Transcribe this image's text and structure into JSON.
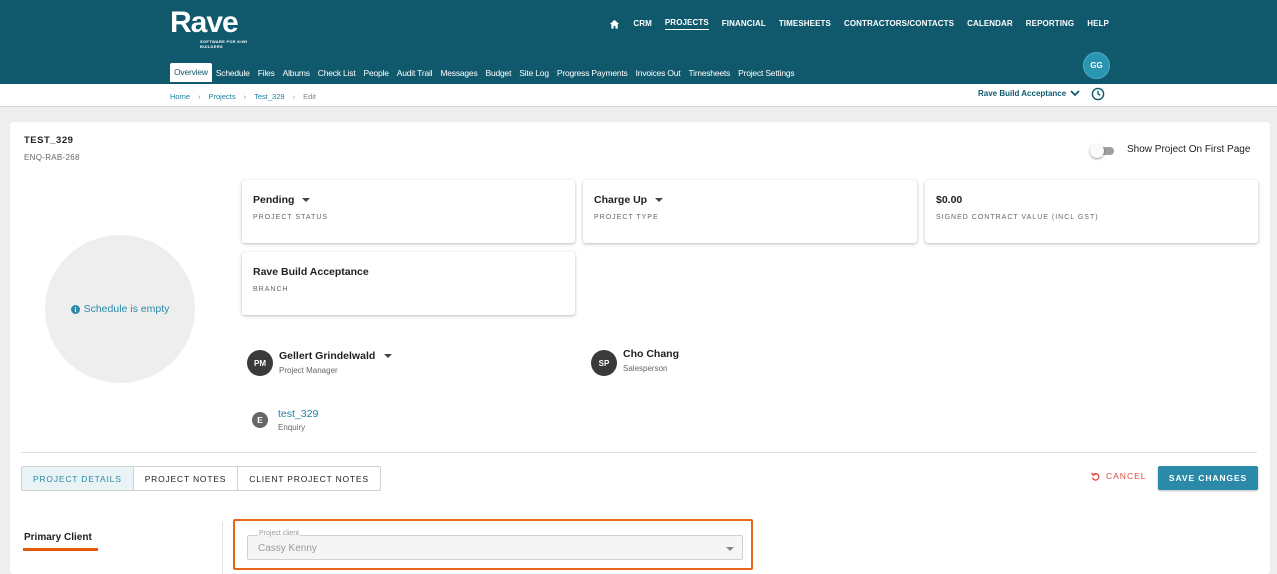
{
  "header": {
    "logo_word": "Rave",
    "logo_tagline": "SOFTWARE FOR KIWI BUILDERS",
    "top_nav": [
      "CRM",
      "PROJECTS",
      "FINANCIAL",
      "TIMESHEETS",
      "CONTRACTORS/CONTACTS",
      "CALENDAR",
      "REPORTING",
      "HELP"
    ],
    "active_top_nav": "PROJECTS",
    "user_initials": "GG",
    "sub_nav": [
      "Overview",
      "Schedule",
      "Files",
      "Albums",
      "Check List",
      "People",
      "Audit Trail",
      "Messages",
      "Budget",
      "Site Log",
      "Progress Payments",
      "Invoices Out",
      "Timesheets",
      "Project Settings"
    ],
    "active_sub_nav": "Overview"
  },
  "breadcrumb": {
    "home": "Home",
    "projects": "Projects",
    "project": "Test_329",
    "current": "Edit"
  },
  "branch_selector": "Rave Build Acceptance",
  "project": {
    "name": "TEST_329",
    "code": "ENQ-RAB-268",
    "show_first_page_label": "Show Project On First Page",
    "show_first_page_on": false,
    "schedule_text": "Schedule is empty"
  },
  "info_boxes": {
    "status": {
      "value": "Pending",
      "label": "PROJECT STATUS"
    },
    "type": {
      "value": "Charge Up",
      "label": "PROJECT TYPE"
    },
    "contract": {
      "value": "$0.00",
      "label": "SIGNED CONTRACT VALUE (INCL GST)"
    },
    "branch": {
      "value": "Rave Build Acceptance",
      "label": "BRANCH"
    }
  },
  "people": {
    "pm": {
      "initials": "PM",
      "name": "Gellert Grindelwald",
      "role": "Project Manager"
    },
    "sp": {
      "initials": "SP",
      "name": "Cho Chang",
      "role": "Salesperson"
    },
    "enquiry": {
      "initial": "E",
      "name": "test_329",
      "role": "Enquiry"
    }
  },
  "tabs": [
    "PROJECT DETAILS",
    "PROJECT NOTES",
    "CLIENT PROJECT NOTES"
  ],
  "active_tab": "PROJECT DETAILS",
  "actions": {
    "cancel": "CANCEL",
    "save": "SAVE CHANGES"
  },
  "primary_client": {
    "section_label": "Primary Client",
    "field_label": "Project client",
    "field_value": "Cassy Kenny"
  },
  "colors": {
    "header_bg": "#10596d",
    "accent": "#2a8aa8",
    "cancel_red": "#e14a3f",
    "highlight_orange": "#e8651c"
  }
}
